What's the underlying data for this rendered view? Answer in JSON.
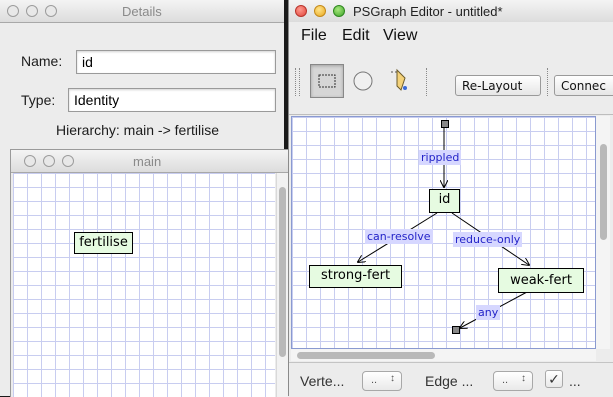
{
  "details": {
    "title": "Details",
    "name_label": "Name:",
    "name_value": "id",
    "type_label": "Type:",
    "type_value": "Identity",
    "hierarchy_text": "Hierarchy: main -> fertilise"
  },
  "main_window": {
    "title": "main",
    "node_label": "fertilise"
  },
  "editor": {
    "title": "PSGraph Editor - untitled*",
    "menu": [
      "File",
      "Edit",
      "View"
    ],
    "toolbar": {
      "relayout_label": "Re-Layout",
      "connect_label": "Connec"
    },
    "graph": {
      "nodes": {
        "id": "id",
        "strong": "strong-fert",
        "weak": "weak-fert"
      },
      "edges": {
        "rippled": "rippled",
        "can_resolve": "can-resolve",
        "reduce_only": "reduce-only",
        "any": "any"
      }
    },
    "status": {
      "vertex_label": "Verte...",
      "vertex_spinner": "..",
      "edge_label": "Edge ...",
      "edge_spinner": "..",
      "check_label": "..."
    }
  },
  "colors": {
    "node_fill": "#e6fbe1",
    "edge_label_bg": "#d6d7ff",
    "edge_label_text": "#2323c8",
    "grid_line": "#c8cdf0"
  }
}
